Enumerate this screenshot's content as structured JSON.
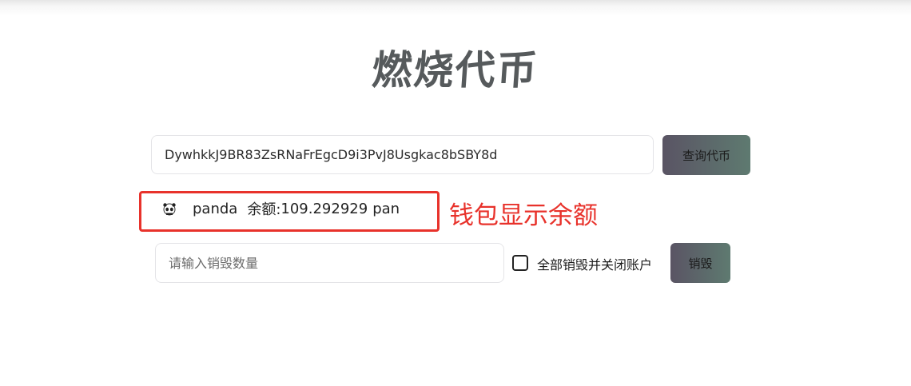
{
  "header": {
    "title": "燃烧代币"
  },
  "query": {
    "address_value": "DywhkkJ9BR83ZsRNaFrEgcD9i3PvJ8Usgkac8bSBY8d",
    "button_label": "查询代币"
  },
  "wallet": {
    "icon": "panda-icon",
    "token_name": "panda",
    "balance_label": "余额:",
    "balance_value": "109.292929",
    "symbol": "pan"
  },
  "annotation": {
    "text": "钱包显示余额",
    "color": "#e8322b"
  },
  "burn": {
    "amount_placeholder": "请输入销毁数量",
    "close_account_label": "全部销毁并关闭账户",
    "close_account_checked": false,
    "button_label": "销毁"
  },
  "colors": {
    "button_gradient_start": "#5a5464",
    "button_gradient_end": "#5e7a70",
    "title_color": "#565a5c"
  }
}
